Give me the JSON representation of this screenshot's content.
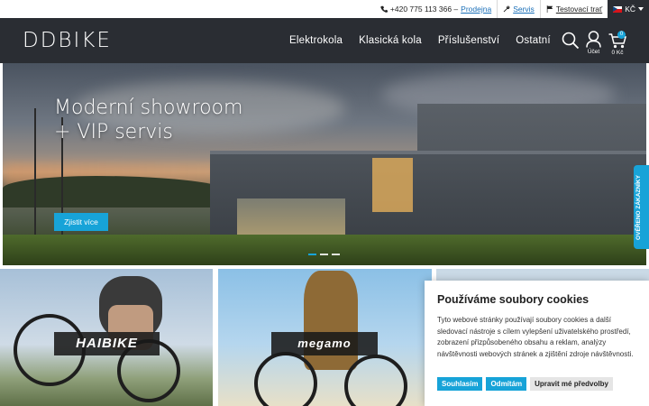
{
  "topbar": {
    "phone": "+420 775 113 366 –",
    "prodejna": "Prodejna",
    "servis": "Servis",
    "testovaci": "Testovací trať",
    "currency": "KČ"
  },
  "header": {
    "logo": "DDBIKE",
    "nav": [
      "Elektrokola",
      "Klasická kola",
      "Příslušenství",
      "Ostatní"
    ],
    "account_label": "Účet",
    "cart_count": "0",
    "cart_price": "0 Kč"
  },
  "hero": {
    "title_line1": "Moderní showroom",
    "title_line2": "+ VIP servis",
    "cta": "Zjistit více",
    "slides": 3,
    "active_slide": 1
  },
  "side_tab": {
    "label": "OVĚŘENO ZÁKAZNÍKY"
  },
  "tiles": [
    {
      "brand": "HAIBIKE"
    },
    {
      "brand": "megamo"
    }
  ],
  "cookie": {
    "title": "Používáme soubory cookies",
    "text": "Tyto webové stránky používají soubory cookies a další sledovací nástroje s cílem vylepšení uživatelského prostředí, zobrazení přizpůsobeného obsahu a reklam, analýzy návštěvnosti webových stránek a zjištění zdroje návštěvnosti.",
    "accept": "Souhlasím",
    "reject": "Odmítám",
    "prefs": "Upravit mé předvolby"
  },
  "colors": {
    "accent": "#17a3d8",
    "header_bg": "#2a2d33",
    "link": "#1a6fb8"
  },
  "icons": [
    "phone-icon",
    "wrench-icon",
    "flag-icon",
    "search-icon",
    "user-icon",
    "cart-icon",
    "chevron-down-icon"
  ]
}
